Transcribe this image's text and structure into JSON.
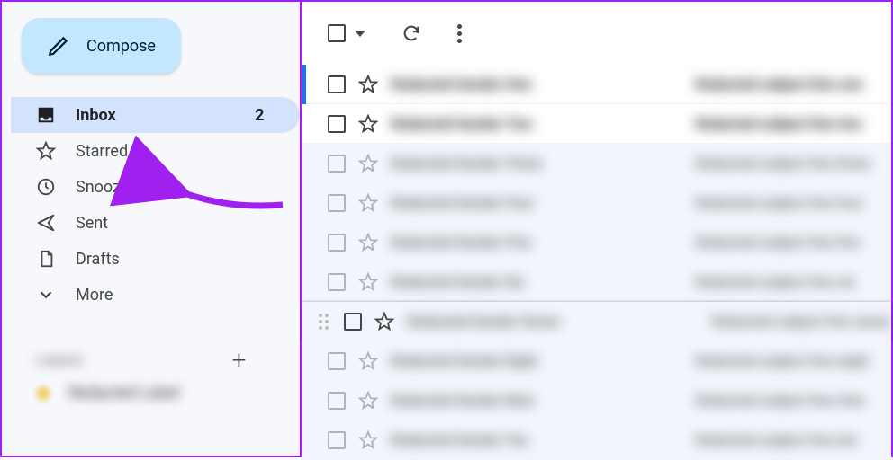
{
  "compose": {
    "label": "Compose"
  },
  "nav": {
    "inbox": {
      "label": "Inbox",
      "badge": "2"
    },
    "starred": {
      "label": "Starred"
    },
    "snoozed": {
      "label": "Snoozed"
    },
    "sent": {
      "label": "Sent"
    },
    "drafts": {
      "label": "Drafts"
    },
    "more": {
      "label": "More"
    }
  },
  "labels": {
    "heading": "Labels",
    "items": [
      {
        "name": "Redacted Label",
        "color": "#f5d273"
      }
    ]
  },
  "mails": [
    {
      "unread": true,
      "selected": true,
      "sender": "Redacted Sender One",
      "subject": "Redacted subject line one"
    },
    {
      "unread": true,
      "sender": "Redacted Sender Two",
      "subject": "Redacted subject line two"
    },
    {
      "unread": false,
      "sender": "Redacted Sender Three",
      "subject": "Redacted subject line three"
    },
    {
      "unread": false,
      "sender": "Redacted Sender Four",
      "subject": "Redacted subject line four"
    },
    {
      "unread": false,
      "sender": "Redacted Sender Five",
      "subject": "Redacted subject line five"
    },
    {
      "unread": false,
      "sender": "Redacted Sender Six",
      "subject": "Redacted subject line six"
    },
    {
      "unread": false,
      "hover": true,
      "sender": "Redacted Sender Seven",
      "subject": "Redacted subject line seven"
    },
    {
      "unread": false,
      "sender": "Redacted Sender Eight",
      "subject": "Redacted subject line eight"
    },
    {
      "unread": false,
      "sender": "Redacted Sender Nine",
      "subject": "Redacted subject line nine"
    },
    {
      "unread": false,
      "sender": "Redacted Sender Ten",
      "subject": "Redacted subject line ten"
    }
  ]
}
